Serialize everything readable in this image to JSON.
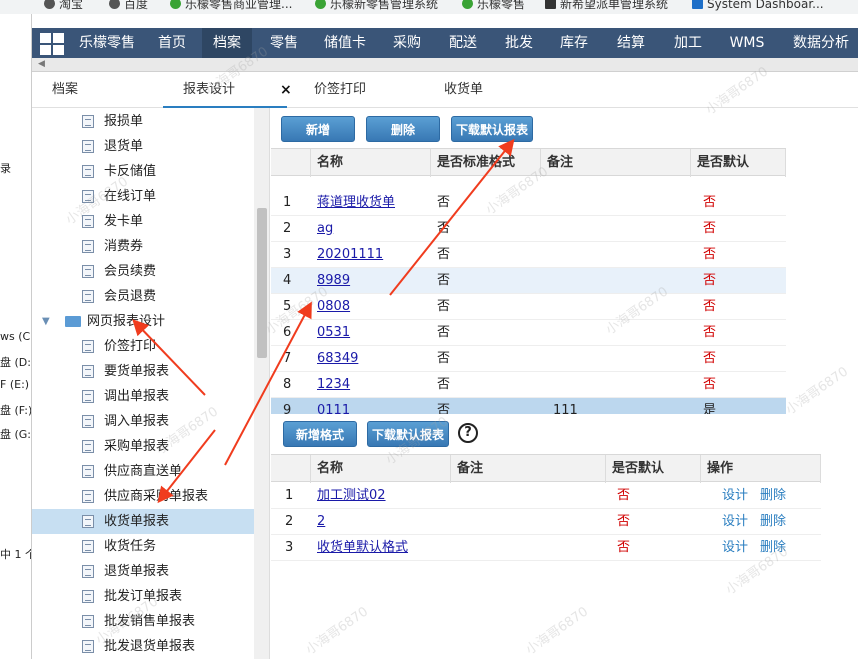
{
  "bookmarks": [
    {
      "label": "淘宝",
      "icon": "browser-icon"
    },
    {
      "label": "百度",
      "icon": "browser-icon"
    },
    {
      "label": "乐檬零售商业管理...",
      "icon": "leaf-icon"
    },
    {
      "label": "乐檬新零售管理系统",
      "icon": "leaf-icon"
    },
    {
      "label": "乐檬零售",
      "icon": "leaf-icon"
    },
    {
      "label": "新希望派单管理系统",
      "icon": "app-icon"
    },
    {
      "label": "System Dashboar...",
      "icon": "app-icon"
    }
  ],
  "background_window": {
    "lines": [
      "录",
      "ws (C",
      "盘 (D:)",
      "F (E:)",
      "盘 (F:)",
      "盘 (G:)",
      "中 1 个"
    ]
  },
  "nav": {
    "brand": "乐檬零售",
    "items": [
      "首页",
      "档案",
      "零售",
      "储值卡",
      "采购",
      "配送",
      "批发",
      "库存",
      "结算",
      "加工",
      "WMS",
      "数据分析"
    ],
    "active": "档案"
  },
  "tabs": [
    {
      "label": "档案"
    },
    {
      "label": "报表设计",
      "active": true,
      "close": "×"
    },
    {
      "label": "价签打印"
    },
    {
      "label": "收货单"
    }
  ],
  "tree": {
    "items_top": [
      "报损单",
      "退货单",
      "卡反储值",
      "在线订单",
      "发卡单",
      "消费券",
      "会员续费",
      "会员退费"
    ],
    "folder": {
      "label": "网页报表设计"
    },
    "items_bottom": [
      "价签打印",
      "要货单报表",
      "调出单报表",
      "调入单报表",
      "采购单报表",
      "供应商直送单",
      "供应商采购单报表",
      "收货单报表",
      "收货任务",
      "退货单报表",
      "批发订单报表",
      "批发销售单报表",
      "批发退货单报表"
    ],
    "selected": "收货单报表"
  },
  "top_toolbar": {
    "add": "新增",
    "delete": "删除",
    "download": "下载默认报表"
  },
  "top_grid": {
    "headers": [
      "名称",
      "是否标准格式",
      "备注",
      "是否默认"
    ],
    "rows": [
      {
        "no": "1",
        "name": "蒋道理收货单",
        "standard": "否",
        "remark": "",
        "default": "否"
      },
      {
        "no": "2",
        "name": "ag",
        "standard": "否",
        "remark": "",
        "default": "否"
      },
      {
        "no": "3",
        "name": "20201111",
        "standard": "否",
        "remark": "",
        "default": "否"
      },
      {
        "no": "4",
        "name": "8989",
        "standard": "否",
        "remark": "",
        "default": "否"
      },
      {
        "no": "5",
        "name": "0808",
        "standard": "否",
        "remark": "",
        "default": "否"
      },
      {
        "no": "6",
        "name": "0531",
        "standard": "否",
        "remark": "",
        "default": "否"
      },
      {
        "no": "7",
        "name": "68349",
        "standard": "否",
        "remark": "",
        "default": "否"
      },
      {
        "no": "8",
        "name": "1234",
        "standard": "否",
        "remark": "",
        "default": "否"
      },
      {
        "no": "9",
        "name": "0111",
        "standard": "否",
        "remark": "111",
        "default": "是"
      }
    ]
  },
  "bottom_toolbar": {
    "add_format": "新增格式",
    "download": "下载默认报表",
    "help": "?"
  },
  "bottom_grid": {
    "headers": [
      "名称",
      "备注",
      "是否默认",
      "操作"
    ],
    "rows": [
      {
        "no": "1",
        "name": "加工测试02",
        "remark": "",
        "default": "否",
        "design": "设计",
        "delete": "删除"
      },
      {
        "no": "2",
        "name": "2",
        "remark": "",
        "default": "否",
        "design": "设计",
        "delete": "删除"
      },
      {
        "no": "3",
        "name": "收货单默认格式",
        "remark": "",
        "default": "否",
        "design": "设计",
        "delete": "删除"
      }
    ]
  },
  "watermark": "小海哥6870",
  "colors": {
    "nav_bg": "#3a5578",
    "button": "#3878b4",
    "selected": "#c7dff2",
    "arrow": "#f03c1e",
    "no": "#d00000"
  }
}
